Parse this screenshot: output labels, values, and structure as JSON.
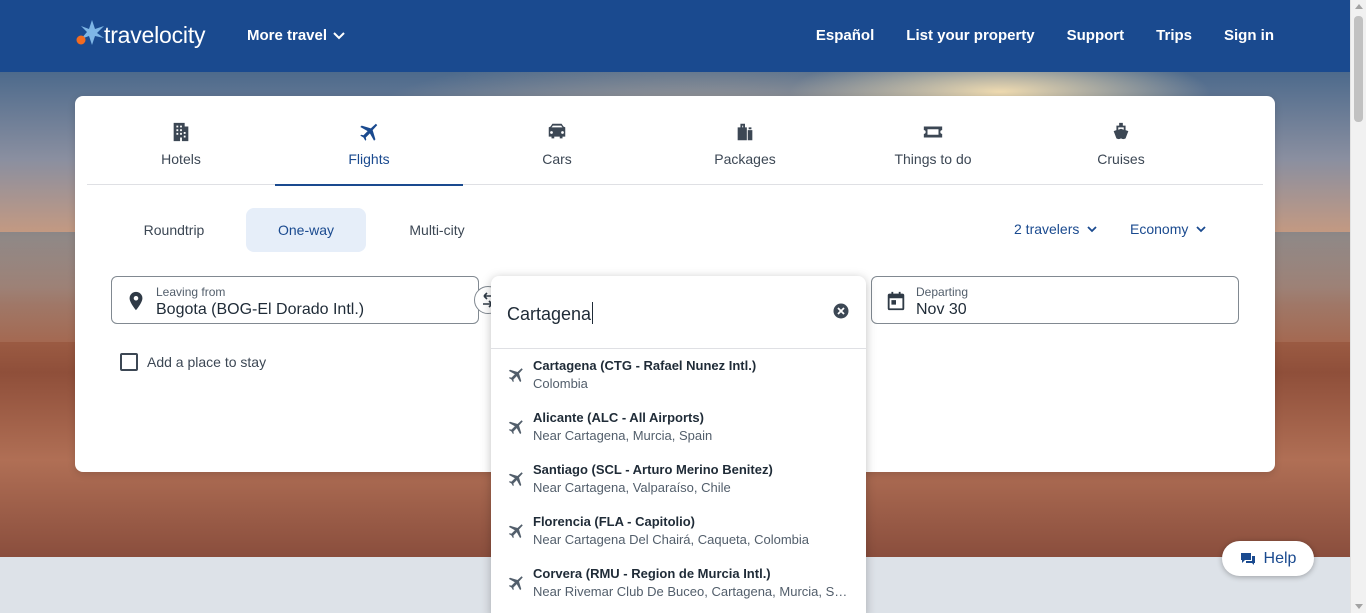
{
  "header": {
    "logo_text": "travelocity",
    "more_travel": "More travel",
    "nav": [
      "Español",
      "List your property",
      "Support",
      "Trips",
      "Sign in"
    ]
  },
  "tabs": [
    {
      "label": "Hotels",
      "icon": "hotel-icon"
    },
    {
      "label": "Flights",
      "icon": "plane-icon",
      "active": true
    },
    {
      "label": "Cars",
      "icon": "car-icon"
    },
    {
      "label": "Packages",
      "icon": "packages-icon"
    },
    {
      "label": "Things to do",
      "icon": "ticket-icon"
    },
    {
      "label": "Cruises",
      "icon": "ship-icon"
    }
  ],
  "trip_types": {
    "roundtrip": "Roundtrip",
    "oneway": "One-way",
    "multicity": "Multi-city",
    "selected": "One-way"
  },
  "travelers": "2 travelers",
  "cabin_class": "Economy",
  "leaving": {
    "label": "Leaving from",
    "value": "Bogota (BOG-El Dorado Intl.)"
  },
  "departing": {
    "label": "Departing",
    "value": "Nov 30"
  },
  "add_stay": "Add a place to stay",
  "search": {
    "query": "Cartagena",
    "results": [
      {
        "title": "Cartagena (CTG - Rafael Nunez Intl.)",
        "subtitle": "Colombia"
      },
      {
        "title": "Alicante (ALC - All Airports)",
        "subtitle": "Near Cartagena, Murcia, Spain"
      },
      {
        "title": "Santiago (SCL - Arturo Merino Benitez)",
        "subtitle": "Near Cartagena, Valparaíso, Chile"
      },
      {
        "title": "Florencia (FLA - Capitolio)",
        "subtitle": "Near Cartagena Del Chairá, Caqueta, Colombia"
      },
      {
        "title": "Corvera (RMU - Region de Murcia Intl.)",
        "subtitle": "Near Rivemar Club De Buceo, Cartagena, Murcia, Spain"
      }
    ]
  },
  "help": "Help",
  "colors": {
    "brand": "#1a4a8f",
    "accent_star": "#f26b21",
    "selected_bg": "#e6eef9"
  }
}
